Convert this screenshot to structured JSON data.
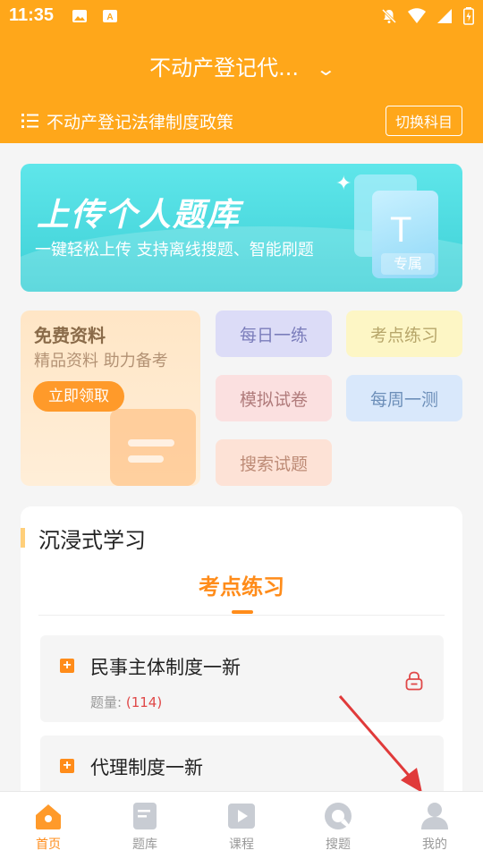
{
  "status_bar": {
    "time": "11:35"
  },
  "header": {
    "subject": "不动产登记代...",
    "category": "不动产登记法律制度政策",
    "switch_label": "切换科目"
  },
  "banner": {
    "title": "上传个人题库",
    "subtitle": "一键轻松上传  支持离线搜题、智能刷题",
    "card_letter": "T",
    "card_tag": "专属"
  },
  "free_card": {
    "title": "免费资料",
    "subtitle": "精品资料 助力备考",
    "button": "立即领取"
  },
  "quick_buttons": {
    "daily": "每日一练",
    "points": "考点练习",
    "mock": "模拟试卷",
    "weekly": "每周一测",
    "search": "搜索试题"
  },
  "study": {
    "title": "沉浸式学习",
    "active_tab": "考点练习",
    "chapters": [
      {
        "title": "民事主体制度一新",
        "count_label": "题量:",
        "count": "(114)"
      },
      {
        "title": "代理制度一新"
      }
    ]
  },
  "tabbar": {
    "items": [
      {
        "label": "首页",
        "icon": "home-icon",
        "active": true
      },
      {
        "label": "题库",
        "icon": "question-bank-icon",
        "active": false
      },
      {
        "label": "课程",
        "icon": "play-icon",
        "active": false
      },
      {
        "label": "搜题",
        "icon": "search-question-icon",
        "active": false
      },
      {
        "label": "我的",
        "icon": "user-icon",
        "active": false
      }
    ]
  },
  "colors": {
    "brand": "#ffa71a",
    "accent": "#ff8c1a",
    "banner": "#4fdce0",
    "annotation_arrow": "#e03a3a"
  }
}
